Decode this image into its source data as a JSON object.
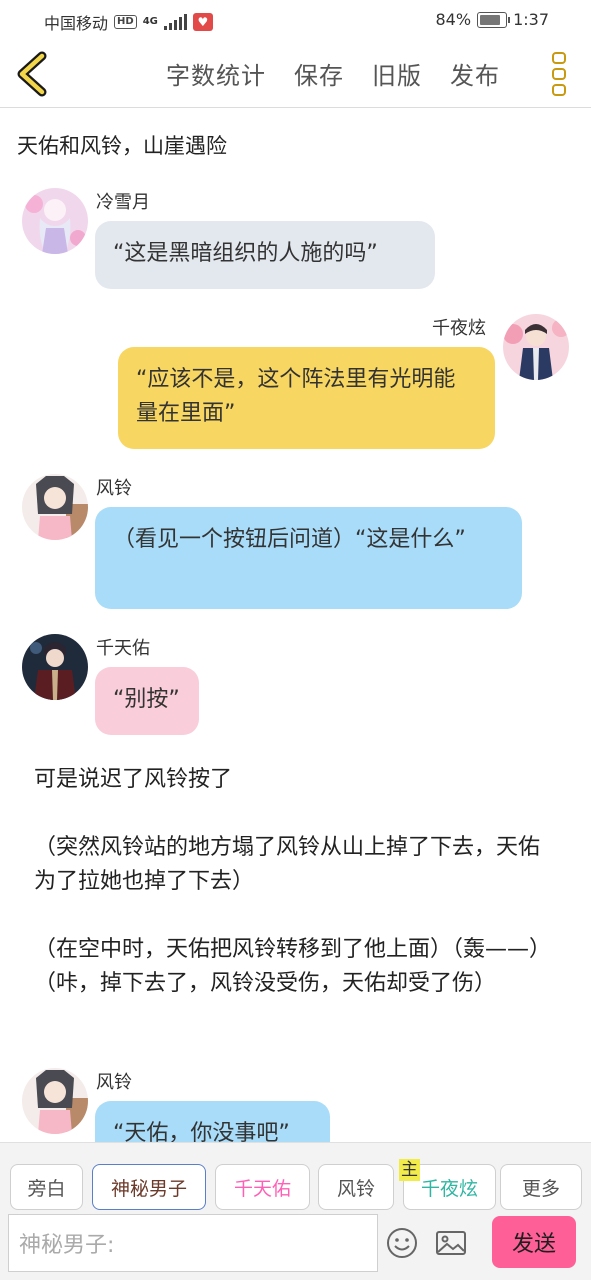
{
  "status_bar": {
    "carrier": "中国移动",
    "hd_badge": "HD",
    "network": "4G",
    "battery_text": "84%",
    "battery_level": 0.84,
    "time": "1:37"
  },
  "toolbar": {
    "word_count": "字数统计",
    "save": "保存",
    "old_version": "旧版",
    "publish": "发布",
    "back_icon": "chevron-left-icon",
    "more_icon": "vertical-dots-icon",
    "accent": "#c99a10"
  },
  "story": {
    "title": "天佑和风铃，山崖遇险"
  },
  "messages": [
    {
      "speaker": "冷雪月",
      "text": "“这是黑暗组织的人施的吗”",
      "color": "#e3e8ef"
    },
    {
      "speaker": "千夜炫",
      "text": "“应该不是，这个阵法里有光明能量在里面”",
      "color": "#f7d662"
    },
    {
      "speaker": "风铃",
      "text": "（看见一个按钮后问道）“这是什么”",
      "color": "#a9dcf8"
    },
    {
      "speaker": "千天佑",
      "text": "“别按”",
      "color": "#f9cdd9"
    },
    {
      "speaker": "风铃",
      "text": "“天佑，你没事吧”",
      "color": "#a9dcf8"
    }
  ],
  "narration": {
    "text": "可是说迟了风铃按了\n\n（突然风铃站的地方塌了风铃从山上掉了下去，天佑为了拉她也掉了下去）\n\n（在空中时，天佑把风铃转移到了他上面）（轰——）（咔，掉下去了，风铃没受伤，天佑却受了伤）"
  },
  "characters": {
    "narrator": "旁白",
    "mystery": "神秘男子",
    "tianyou": "千天佑",
    "fengling": "风铃",
    "qianyexuan": "千夜炫",
    "main_tag": "主",
    "more": "更多"
  },
  "input": {
    "placeholder": "神秘男子:",
    "send": "发送",
    "emoji_icon": "smiley-icon",
    "image_icon": "image-icon",
    "send_color": "#ff5f97"
  }
}
